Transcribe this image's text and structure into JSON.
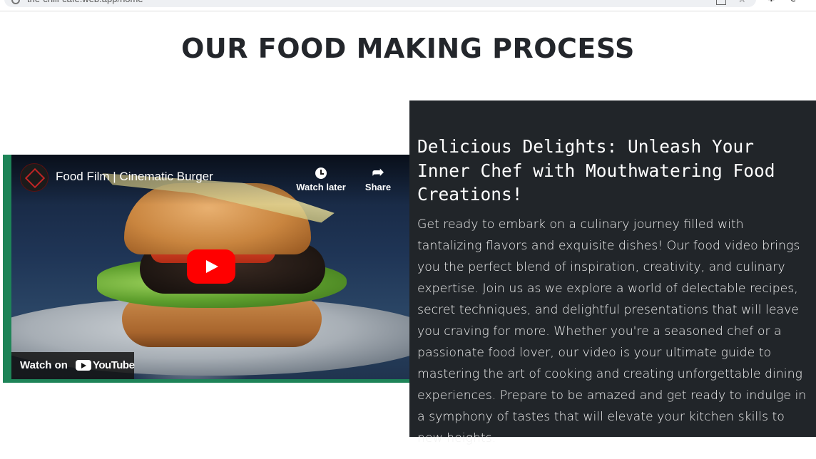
{
  "browser": {
    "url": "the-chill-cafe.web.app/home"
  },
  "page": {
    "title": "OUR FOOD MAKING PROCESS"
  },
  "video": {
    "title": "Food Film | Cinematic Burger",
    "watch_later_label": "Watch later",
    "share_label": "Share",
    "watch_on_label": "Watch on",
    "youtube_label": "YouTube",
    "frame_color": "#1e8458",
    "play_button_color": "#ff0000"
  },
  "description": {
    "heading": "Delicious Delights: Unleash Your Inner Chef with Mouthwatering Food Creations!",
    "body": "Get ready to embark on a culinary journey filled with tantalizing flavors and exquisite dishes! Our food video brings you the perfect blend of inspiration, creativity, and culinary expertise. Join us as we explore a world of delectable recipes, secret techniques, and delightful presentations that will leave you craving for more. Whether you're a seasoned chef or a passionate food lover, our video is your ultimate guide to mastering the art of cooking and creating unforgettable dining experiences. Prepare to be amazed and get ready to indulge in a symphony of tastes that will elevate your kitchen skills to new heights.",
    "panel_color": "#212529"
  },
  "icons": {
    "lock": "lock-icon",
    "bookmark_star": "star-icon",
    "extensions": "puzzle-icon",
    "sync": "sync-icon",
    "clock": "clock-icon",
    "share": "share-arrow-icon",
    "play": "play-icon",
    "youtube": "youtube-logo-icon"
  }
}
